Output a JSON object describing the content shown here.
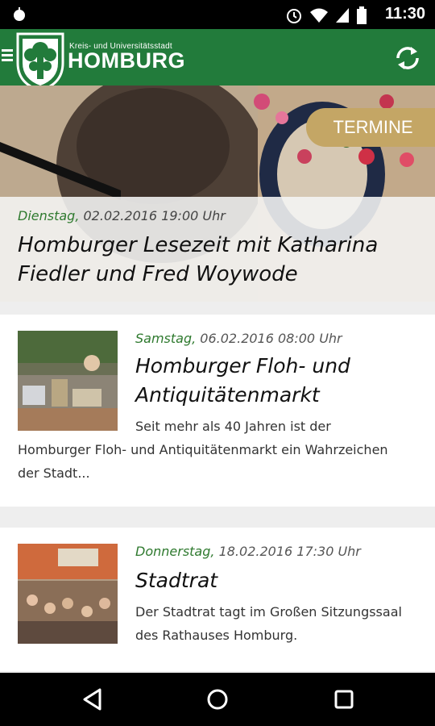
{
  "status_bar": {
    "time": "11:30"
  },
  "app_bar": {
    "city_small": "Kreis- und Universitätsstadt",
    "city_big": "HOMBURG",
    "icons": {
      "menu": "menu-icon",
      "crest": "city-crest",
      "refresh": "refresh-icon"
    },
    "brand_color": "#227b3b"
  },
  "hero": {
    "tab_label": "TERMINE",
    "tab_color": "#c4a665",
    "weekday": "Dienstag,",
    "datetime": "02.02.2016 19:00 Uhr",
    "title": "Homburger Lesezeit mit Katharina Fiedler und Fred Woywode"
  },
  "events": [
    {
      "weekday": "Samstag,",
      "datetime": "06.02.2016 08:00 Uhr",
      "title": "Homburger Floh- und Antiquitätenmarkt",
      "text_right": "Seit mehr als 40 Jahren ist der",
      "text_full": "Homburger Floh- und Antiquitätenmarkt ein Wahrzeichen",
      "text_last": "der Stadt..."
    },
    {
      "weekday": "Donnerstag,",
      "datetime": "18.02.2016 17:30 Uhr",
      "title": "Stadtrat",
      "text_line1": "Der Stadtrat tagt im Großen Sitzungssaal",
      "text_line2": "des Rathauses Homburg."
    }
  ],
  "nav_bar": {
    "icons": [
      "back-icon",
      "home-icon",
      "recents-icon"
    ]
  }
}
